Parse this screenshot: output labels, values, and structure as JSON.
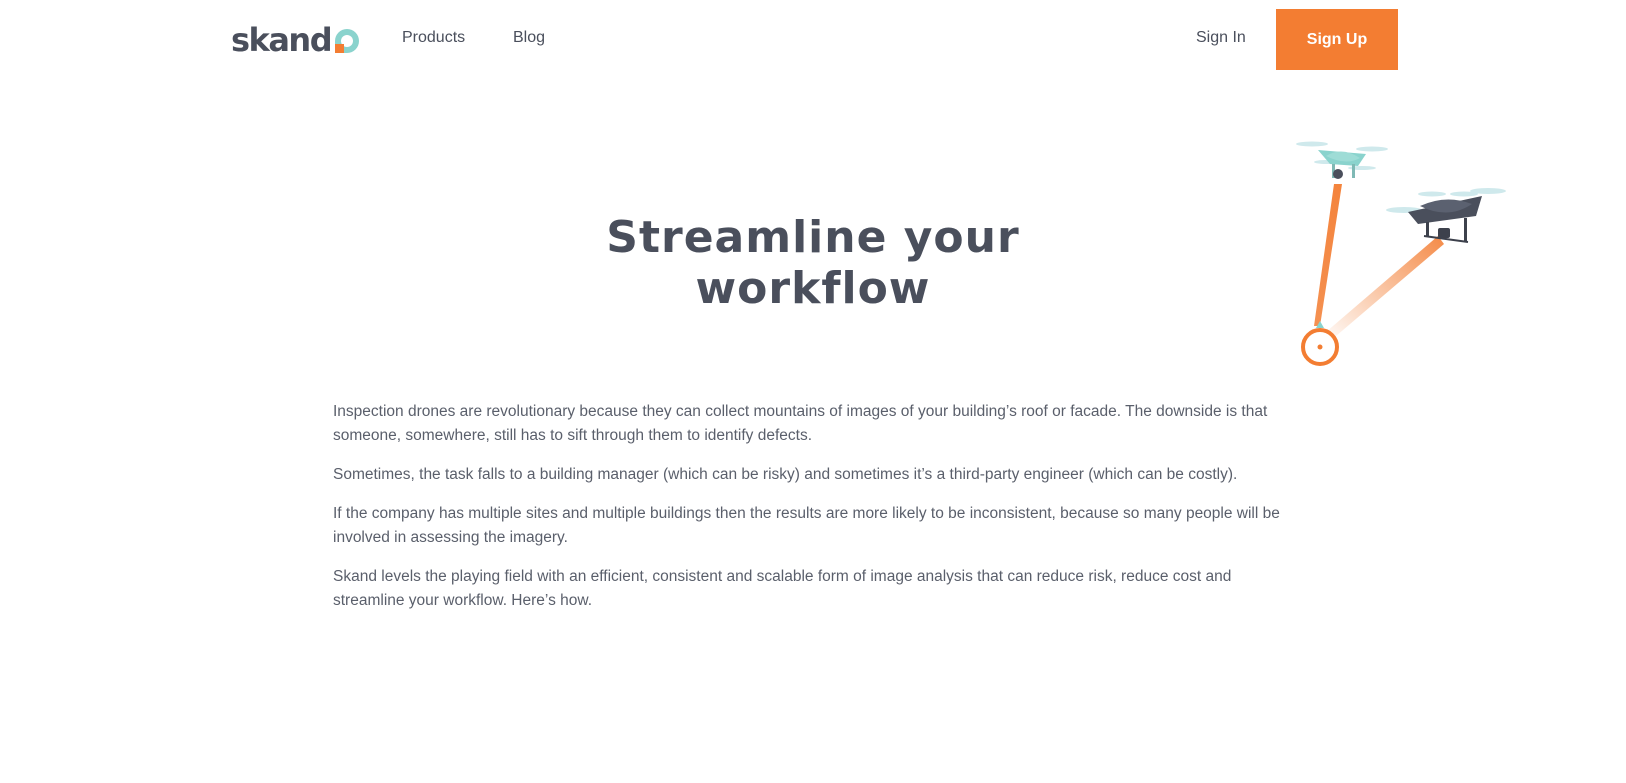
{
  "brand": {
    "logo_text": "skand",
    "accent_color": "#f37d32",
    "teal_color": "#8ad3cd",
    "text_color": "#4a4f5c"
  },
  "nav": {
    "products": "Products",
    "blog": "Blog",
    "sign_in": "Sign In",
    "sign_up": "Sign Up"
  },
  "hero": {
    "title_line1": "Streamline your",
    "title_line2": "workflow",
    "illustration_icon": "drones-icon"
  },
  "content": {
    "paragraphs": [
      "Inspection drones are revolutionary because they can collect mountains of images of your building’s roof or facade. The downside is that someone, somewhere, still has to sift through them to identify defects.",
      "Sometimes, the task falls to a building manager (which can be risky) and sometimes it’s a third-party engineer (which can be costly).",
      "If the company has multiple sites and multiple buildings then the results are more likely to be inconsistent, because so many people will be involved in assessing the imagery.",
      "Skand levels the playing field with an efficient, consistent and scalable form of image analysis that can reduce risk, reduce cost and streamline your workflow. Here’s how."
    ]
  }
}
